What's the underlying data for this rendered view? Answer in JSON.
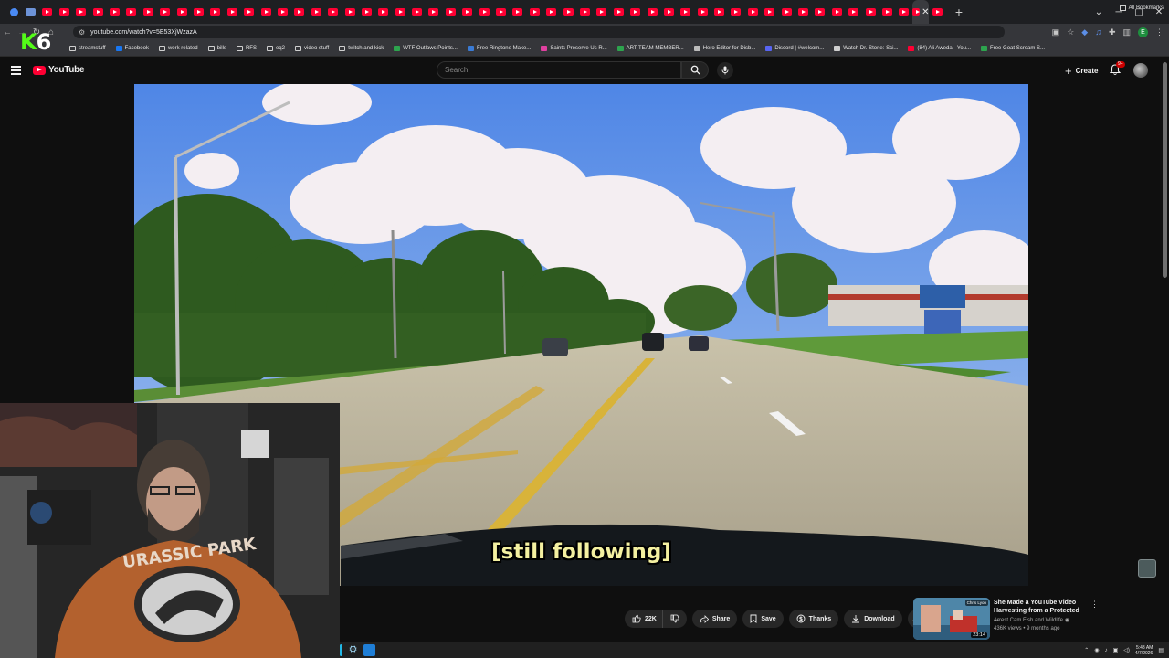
{
  "browser": {
    "tab_count": 56,
    "active_tab_index": 54,
    "new_tab_symbol": "+",
    "url": "youtube.com/watch?v=5E53XjWzazA",
    "profile_initial": "E",
    "bookmarks": [
      {
        "label": "streamstuff",
        "icon": "folder-icon",
        "color": "#cfcfcf"
      },
      {
        "label": "Facebook",
        "icon": "facebook-icon",
        "color": "#1877f2"
      },
      {
        "label": "work related",
        "icon": "folder-icon",
        "color": "#cfcfcf"
      },
      {
        "label": "bills",
        "icon": "folder-icon",
        "color": "#cfcfcf"
      },
      {
        "label": "RFS",
        "icon": "folder-icon",
        "color": "#cfcfcf"
      },
      {
        "label": "eq2",
        "icon": "folder-icon",
        "color": "#cfcfcf"
      },
      {
        "label": "video stuff",
        "icon": "folder-icon",
        "color": "#cfcfcf"
      },
      {
        "label": "twitch and kick",
        "icon": "folder-icon",
        "color": "#cfcfcf"
      },
      {
        "label": "WTF Outlaws Points...",
        "icon": "sheet-icon",
        "color": "#2da44e"
      },
      {
        "label": "Free Ringtone Make...",
        "icon": "music-icon",
        "color": "#3a7bd5"
      },
      {
        "label": "Saints Preserve Us R...",
        "icon": "site-icon",
        "color": "#e040a0"
      },
      {
        "label": "ART TEAM MEMBER...",
        "icon": "sheet-icon",
        "color": "#2da44e"
      },
      {
        "label": "Hero Editor for Disb...",
        "icon": "page-icon",
        "color": "#bbbbbb"
      },
      {
        "label": "Discord | #welcom...",
        "icon": "discord-icon",
        "color": "#5865f2"
      },
      {
        "label": "Watch Dr. Stone: Sci...",
        "icon": "globe-icon",
        "color": "#cfcfcf"
      },
      {
        "label": "(84) Ali Aweda - You...",
        "icon": "youtube-icon",
        "color": "#ff0033"
      },
      {
        "label": "Free Goat Scream S...",
        "icon": "site-icon",
        "color": "#2da44e"
      }
    ],
    "all_bookmarks": "All Bookmarks"
  },
  "overlay_logo": {
    "k": "K",
    "six": "6"
  },
  "youtube": {
    "logo_text": "YouTube",
    "search_placeholder": "Search",
    "create_label": "Create",
    "notifications_badge": "9+",
    "caption": "[still following]",
    "actions": {
      "likes": "22K",
      "share": "Share",
      "save": "Save",
      "thanks": "Thanks",
      "download": "Download",
      "more": "…"
    },
    "suggested": {
      "title": "She Made a YouTube Video Harvesting from a Protected ...",
      "channel": "Arrest Cam Fish and Wildlife",
      "meta": "436K views • 9 months ago",
      "duration": "23:14",
      "thumb_badge": "Chris Lyon"
    }
  },
  "taskbar": {
    "time": "5:43 AM",
    "date": "4/7/2026"
  },
  "colors": {
    "yt_red": "#ff0033",
    "kick_green": "#53fc18",
    "caption_yellow": "#f4f0a0"
  }
}
